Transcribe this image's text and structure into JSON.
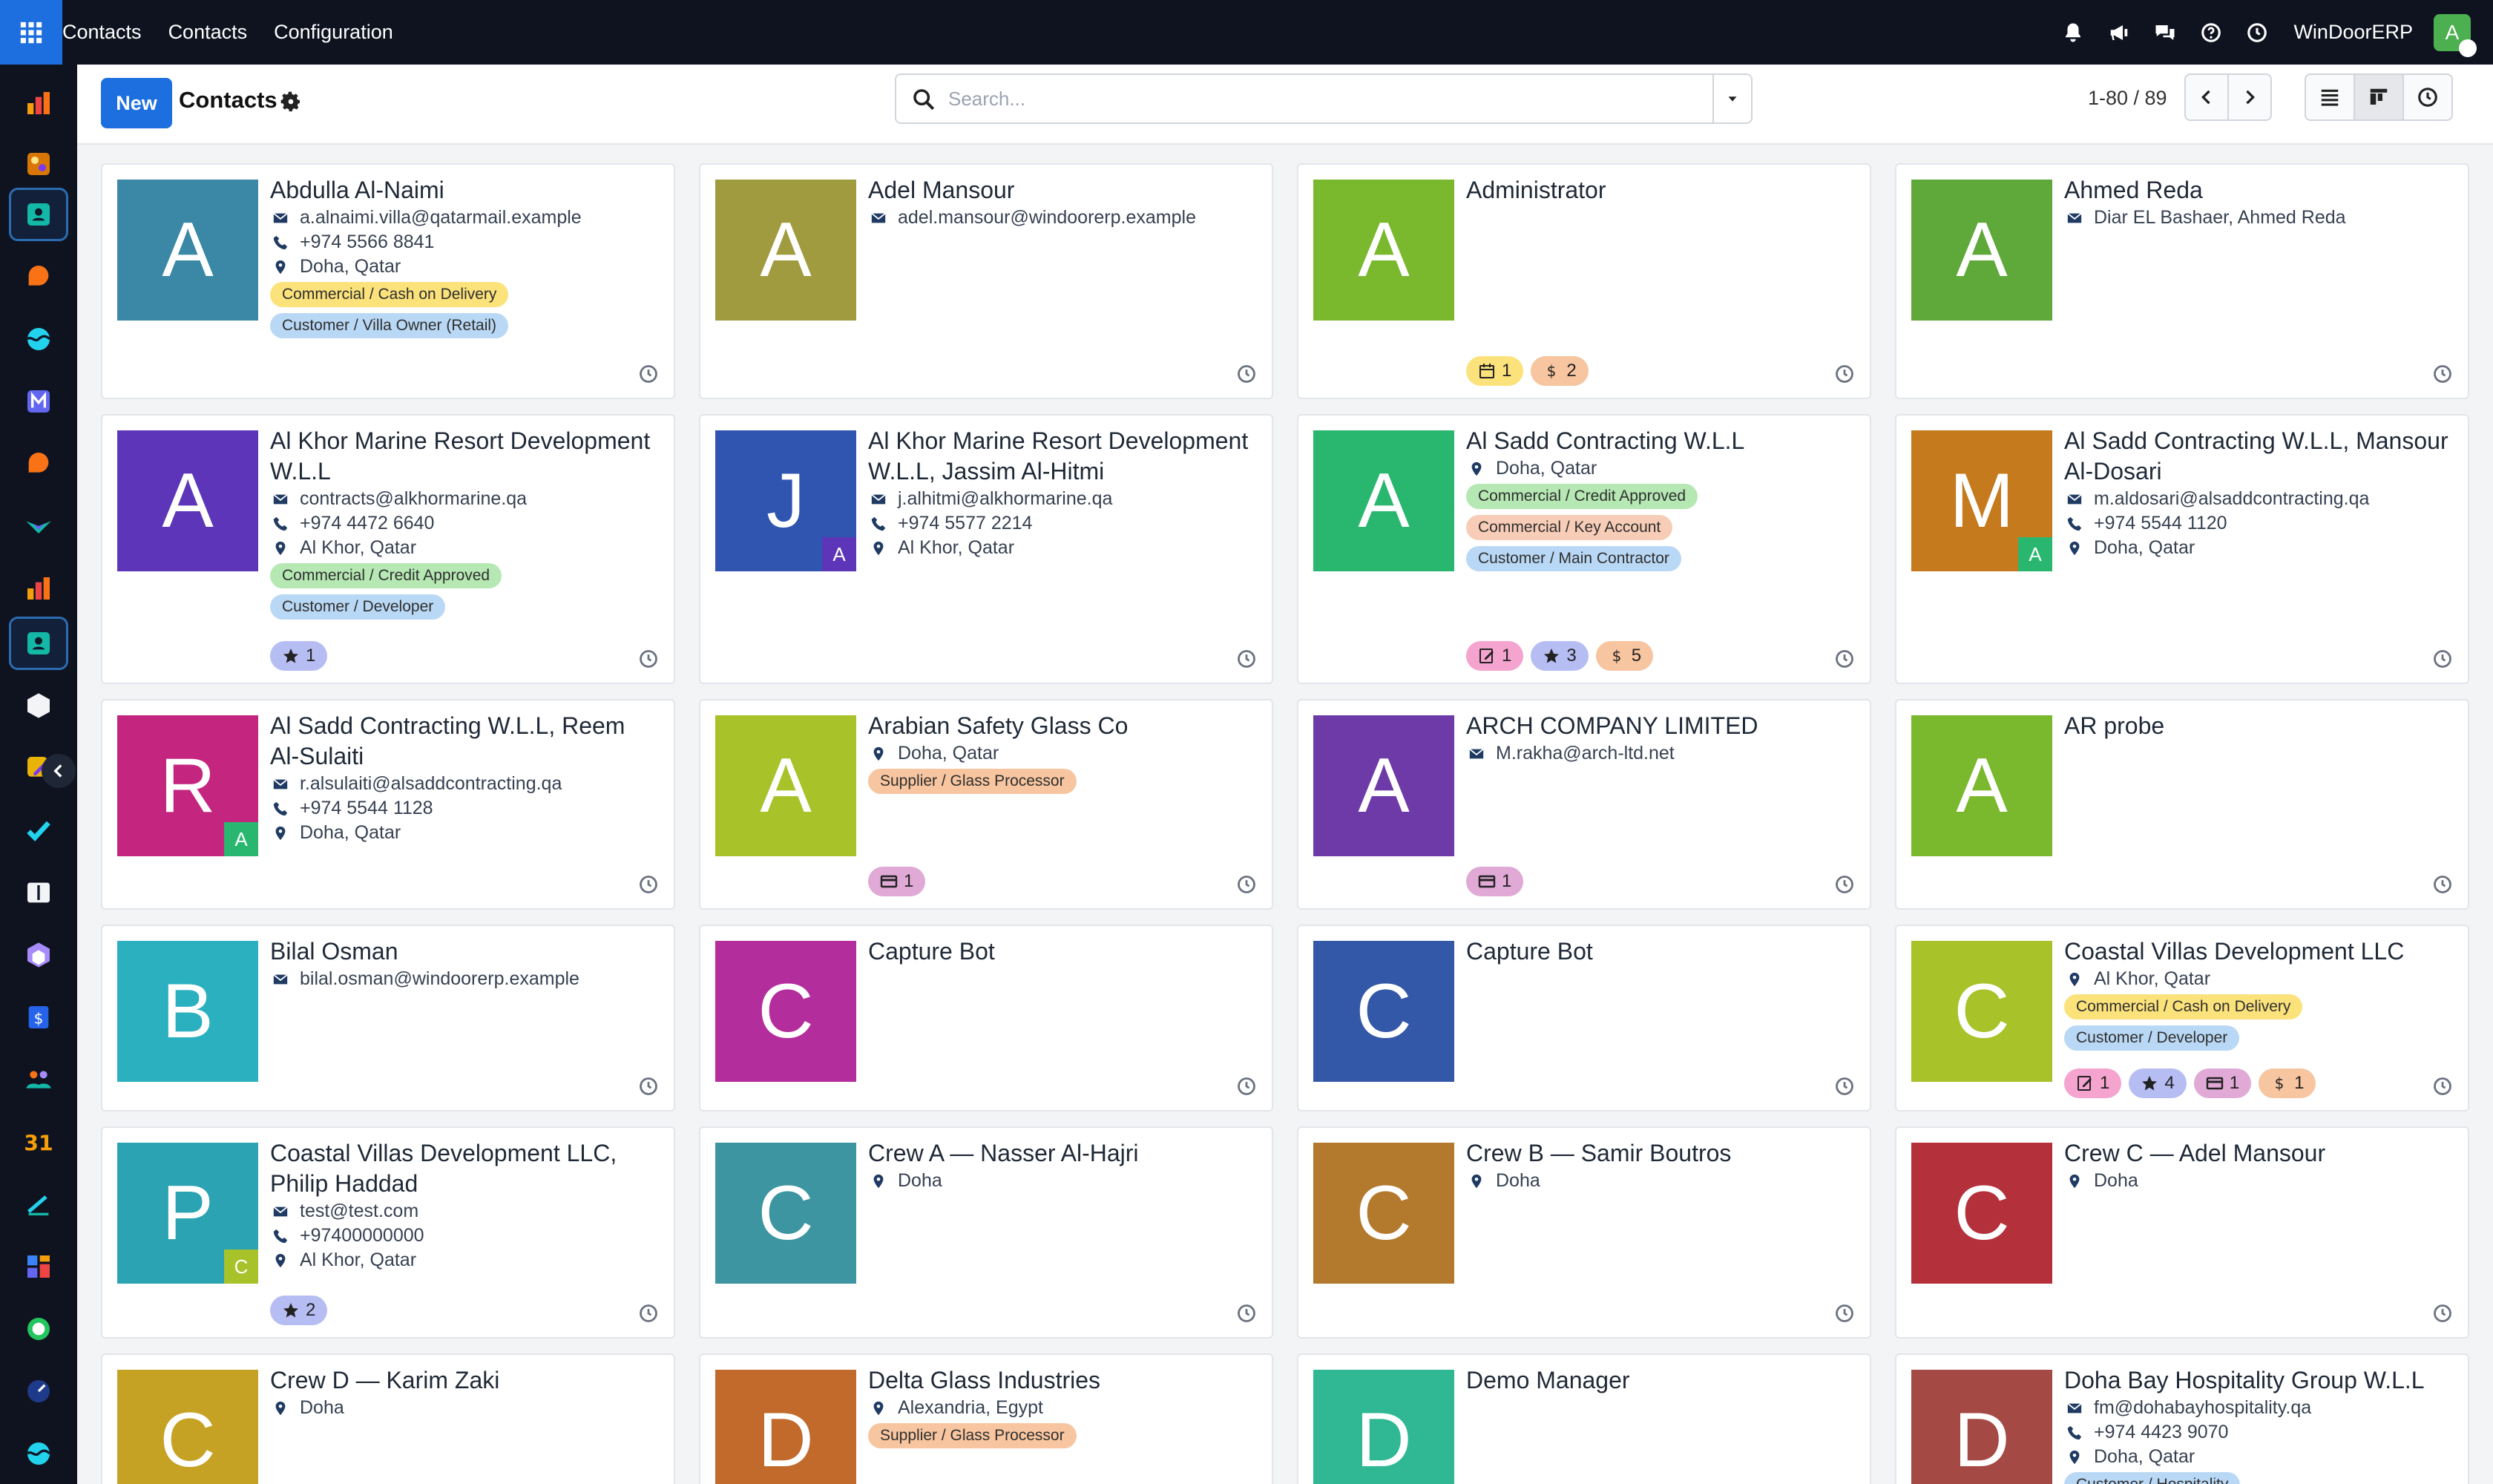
{
  "topbar": {
    "menus": [
      "Contacts",
      "Contacts",
      "Configuration"
    ],
    "company": "WinDoorERP",
    "user_initial": "A"
  },
  "control": {
    "new_label": "New",
    "title": "Contacts",
    "search_placeholder": "Search...",
    "pager": "1-80 / 89"
  },
  "cards": [
    {
      "name": "Abdulla Al-Naimi",
      "initial": "A",
      "color": "#3a87a6",
      "lines": [
        {
          "icon": "email",
          "text": "a.alnaimi.villa@qatarmail.example"
        },
        {
          "icon": "phone",
          "text": "+974 5566 8841"
        },
        {
          "icon": "location",
          "text": "Doha, Qatar"
        }
      ],
      "tags": [
        {
          "text": "Commercial / Cash on Delivery",
          "color": "#fbe27b"
        },
        {
          "text": "Customer / Villa Owner (Retail)",
          "color": "#b9d8f5"
        }
      ],
      "chips": []
    },
    {
      "name": "Adel Mansour",
      "initial": "A",
      "color": "#a09b3e",
      "lines": [
        {
          "icon": "email",
          "text": "adel.mansour@windoorerp.example"
        }
      ],
      "tags": [],
      "chips": []
    },
    {
      "name": "Administrator",
      "initial": "A",
      "color": "#7ab82e",
      "lines": [],
      "tags": [],
      "chips": [
        {
          "icon": "calendar",
          "count": "1",
          "color": "#fbe27b"
        },
        {
          "icon": "dollar",
          "count": "2",
          "color": "#f7c59f"
        }
      ]
    },
    {
      "name": "Ahmed Reda",
      "initial": "A",
      "color": "#5fa83a",
      "lines": [
        {
          "icon": "email",
          "text": "Diar EL Bashaer, Ahmed Reda"
        }
      ],
      "tags": [],
      "chips": []
    },
    {
      "name": "Al Khor Marine Resort Development W.L.L",
      "initial": "A",
      "color": "#5d35b8",
      "lines": [
        {
          "icon": "email",
          "text": "contracts@alkhormarine.qa"
        },
        {
          "icon": "phone",
          "text": "+974 4472 6640"
        },
        {
          "icon": "location",
          "text": "Al Khor, Qatar"
        }
      ],
      "tags": [
        {
          "text": "Commercial / Credit Approved",
          "color": "#b5e8b3"
        },
        {
          "text": "Customer / Developer",
          "color": "#b9d8f5"
        }
      ],
      "chips": [
        {
          "icon": "star",
          "count": "1",
          "color": "#b6bdf3"
        }
      ]
    },
    {
      "name": "Al Khor Marine Resort Development W.L.L, Jassim Al-Hitmi",
      "initial": "J",
      "color": "#3055b0",
      "badge": {
        "initial": "A",
        "color": "#5d35b8"
      },
      "lines": [
        {
          "icon": "email",
          "text": "j.alhitmi@alkhormarine.qa"
        },
        {
          "icon": "phone",
          "text": "+974 5577 2214"
        },
        {
          "icon": "location",
          "text": "Al Khor, Qatar"
        }
      ],
      "tags": [],
      "chips": []
    },
    {
      "name": "Al Sadd Contracting W.L.L",
      "initial": "A",
      "color": "#29b770",
      "lines": [
        {
          "icon": "location",
          "text": "Doha, Qatar"
        }
      ],
      "tags": [
        {
          "text": "Commercial / Credit Approved",
          "color": "#b5e8b3"
        },
        {
          "text": "Commercial / Key Account",
          "color": "#f8cdb7"
        },
        {
          "text": "Customer / Main Contractor",
          "color": "#b9d8f5"
        }
      ],
      "chips": [
        {
          "icon": "edit",
          "count": "1",
          "color": "#f5a3cf"
        },
        {
          "icon": "star",
          "count": "3",
          "color": "#b6bdf3"
        },
        {
          "icon": "dollar",
          "count": "5",
          "color": "#f7c59f"
        }
      ]
    },
    {
      "name": "Al Sadd Contracting W.L.L, Mansour Al-Dosari",
      "initial": "M",
      "color": "#c57a1e",
      "badge": {
        "initial": "A",
        "color": "#29b770"
      },
      "lines": [
        {
          "icon": "email",
          "text": "m.aldosari@alsaddcontracting.qa"
        },
        {
          "icon": "phone",
          "text": "+974 5544 1120"
        },
        {
          "icon": "location",
          "text": "Doha, Qatar"
        }
      ],
      "tags": [],
      "chips": []
    },
    {
      "name": "Al Sadd Contracting W.L.L, Reem Al-Sulaiti",
      "initial": "R",
      "color": "#c4267f",
      "badge": {
        "initial": "A",
        "color": "#29b770"
      },
      "lines": [
        {
          "icon": "email",
          "text": "r.alsulaiti@alsaddcontracting.qa"
        },
        {
          "icon": "phone",
          "text": "+974 5544 1128"
        },
        {
          "icon": "location",
          "text": "Doha, Qatar"
        }
      ],
      "tags": [],
      "chips": []
    },
    {
      "name": "Arabian Safety Glass Co",
      "initial": "A",
      "color": "#a8c22a",
      "lines": [
        {
          "icon": "location",
          "text": "Doha, Qatar"
        }
      ],
      "tags": [
        {
          "text": "Supplier / Glass Processor",
          "color": "#f7c59f"
        }
      ],
      "chips": [
        {
          "icon": "card",
          "count": "1",
          "color": "#e0a9d6"
        }
      ]
    },
    {
      "name": "ARCH COMPANY LIMITED",
      "initial": "A",
      "color": "#6d3aa8",
      "lines": [
        {
          "icon": "email",
          "text": "M.rakha@arch-ltd.net"
        }
      ],
      "tags": [],
      "chips": [
        {
          "icon": "card",
          "count": "1",
          "color": "#e0a9d6"
        }
      ]
    },
    {
      "name": "AR probe",
      "initial": "A",
      "color": "#7ab82e",
      "lines": [],
      "tags": [],
      "chips": []
    },
    {
      "name": "Bilal Osman",
      "initial": "B",
      "color": "#2bb0c0",
      "lines": [
        {
          "icon": "email",
          "text": "bilal.osman@windoorerp.example"
        }
      ],
      "tags": [],
      "chips": []
    },
    {
      "name": "Capture Bot",
      "initial": "C",
      "color": "#b42d9c",
      "lines": [],
      "tags": [],
      "chips": []
    },
    {
      "name": "Capture Bot",
      "initial": "C",
      "color": "#3458a8",
      "lines": [],
      "tags": [],
      "chips": []
    },
    {
      "name": "Coastal Villas Development LLC",
      "initial": "C",
      "color": "#a8c22a",
      "lines": [
        {
          "icon": "location",
          "text": "Al Khor, Qatar"
        }
      ],
      "tags": [
        {
          "text": "Commercial / Cash on Delivery",
          "color": "#fbe27b"
        },
        {
          "text": "Customer / Developer",
          "color": "#b9d8f5"
        }
      ],
      "chips": [
        {
          "icon": "edit",
          "count": "1",
          "color": "#f5a3cf"
        },
        {
          "icon": "star",
          "count": "4",
          "color": "#b6bdf3"
        },
        {
          "icon": "card",
          "count": "1",
          "color": "#e0a9d6"
        },
        {
          "icon": "dollar",
          "count": "1",
          "color": "#f7c59f"
        }
      ]
    },
    {
      "name": "Coastal Villas Development LLC, Philip Haddad",
      "initial": "P",
      "color": "#2ba3b3",
      "badge": {
        "initial": "C",
        "color": "#a8c22a"
      },
      "lines": [
        {
          "icon": "email",
          "text": "test@test.com"
        },
        {
          "icon": "phone",
          "text": "+97400000000"
        },
        {
          "icon": "location",
          "text": "Al Khor, Qatar"
        }
      ],
      "tags": [],
      "chips": [
        {
          "icon": "star",
          "count": "2",
          "color": "#b6bdf3"
        }
      ]
    },
    {
      "name": "Crew A — Nasser Al-Hajri",
      "initial": "C",
      "color": "#3c95a0",
      "lines": [
        {
          "icon": "location",
          "text": "Doha"
        }
      ],
      "tags": [],
      "chips": []
    },
    {
      "name": "Crew B — Samir Boutros",
      "initial": "C",
      "color": "#b37a2e",
      "lines": [
        {
          "icon": "location",
          "text": "Doha"
        }
      ],
      "tags": [],
      "chips": []
    },
    {
      "name": "Crew C — Adel Mansour",
      "initial": "C",
      "color": "#b4313c",
      "lines": [
        {
          "icon": "location",
          "text": "Doha"
        }
      ],
      "tags": [],
      "chips": []
    },
    {
      "name": "Crew D — Karim Zaki",
      "initial": "C",
      "color": "#c6a224",
      "lines": [
        {
          "icon": "location",
          "text": "Doha"
        }
      ],
      "tags": [],
      "chips": []
    },
    {
      "name": "Delta Glass Industries",
      "initial": "D",
      "color": "#c2692c",
      "lines": [
        {
          "icon": "location",
          "text": "Alexandria, Egypt"
        }
      ],
      "tags": [
        {
          "text": "Supplier / Glass Processor",
          "color": "#f7c59f"
        }
      ],
      "chips": []
    },
    {
      "name": "Demo Manager",
      "initial": "D",
      "color": "#2fb893",
      "lines": [],
      "tags": [],
      "chips": []
    },
    {
      "name": "Doha Bay Hospitality Group W.L.L",
      "initial": "D",
      "color": "#a54944",
      "lines": [
        {
          "icon": "email",
          "text": "fm@dohabayhospitality.qa"
        },
        {
          "icon": "phone",
          "text": "+974 4423 9070"
        },
        {
          "icon": "location",
          "text": "Doha, Qatar"
        }
      ],
      "tags": [
        {
          "text": "Customer / Hospitality",
          "color": "#b9d8f5"
        }
      ],
      "chips": []
    }
  ]
}
